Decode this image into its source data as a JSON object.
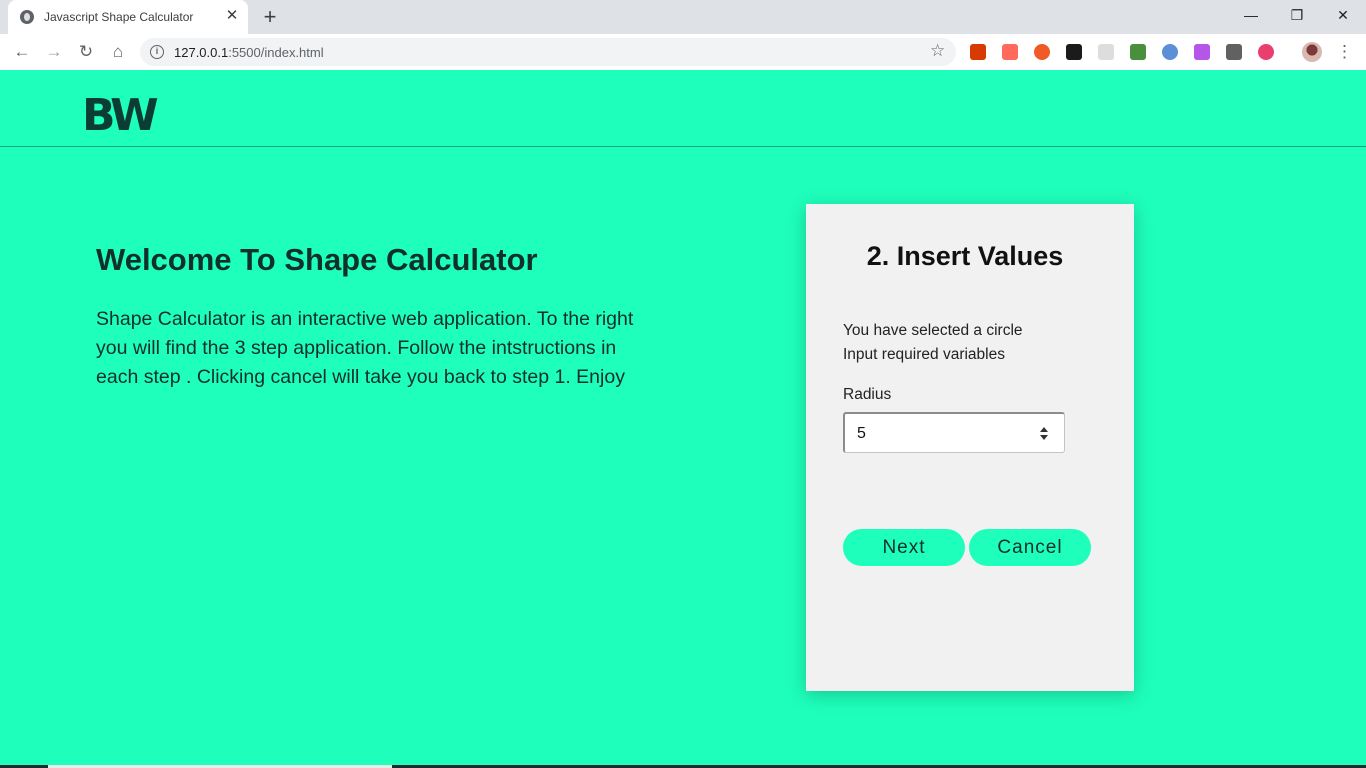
{
  "browser": {
    "tab_title": "Javascript Shape Calculator",
    "tab_close": "✕",
    "new_tab": "+",
    "url_host": "127.0.0.1",
    "url_rest": ":5500/index.html",
    "window_controls": {
      "minimize": "—",
      "restore": "❐",
      "close": "✕"
    },
    "nav": {
      "back": "←",
      "forward": "→",
      "reload": "↻",
      "home": "⌂"
    },
    "star": "☆",
    "menu": "⋮"
  },
  "header": {
    "logo": "BW"
  },
  "intro": {
    "title": "Welcome To Shape Calculator",
    "paragraph": "Shape Calculator is an interactive web application. To the right you will find the 3 step application. Follow the intstructions in each step . Clicking cancel will take you back to step 1. Enjoy"
  },
  "card": {
    "title": "2. Insert Values",
    "selection_text": "You have selected a circle",
    "instruction_text": "Input required variables",
    "field_label": "Radius",
    "field_value": "5",
    "next_label": "Next",
    "cancel_label": "Cancel"
  },
  "colors": {
    "page_background": "#1effbb",
    "card_background": "#f1f1f1",
    "text_dark": "#12302a",
    "logo": "#0c3d33"
  },
  "extensions": [
    {
      "name": "office-extension-icon",
      "color": "#d83b01"
    },
    {
      "name": "play-extension-icon",
      "color": "#ff6a5c"
    },
    {
      "name": "infinity-extension-icon",
      "color": "#f15a24"
    },
    {
      "name": "github-extension-icon",
      "color": "#1b1b1b"
    },
    {
      "name": "blank-extension-icon",
      "color": "#dddddd"
    },
    {
      "name": "pen-extension-icon",
      "color": "#4a8f3c"
    },
    {
      "name": "shield-extension-icon",
      "color": "#5b8fd6"
    },
    {
      "name": "pink-extension-icon",
      "color": "#b556e8"
    },
    {
      "name": "angular-extension-icon",
      "color": "#616161"
    },
    {
      "name": "color-wheel-extension-icon",
      "color": "#e83f6f"
    }
  ]
}
